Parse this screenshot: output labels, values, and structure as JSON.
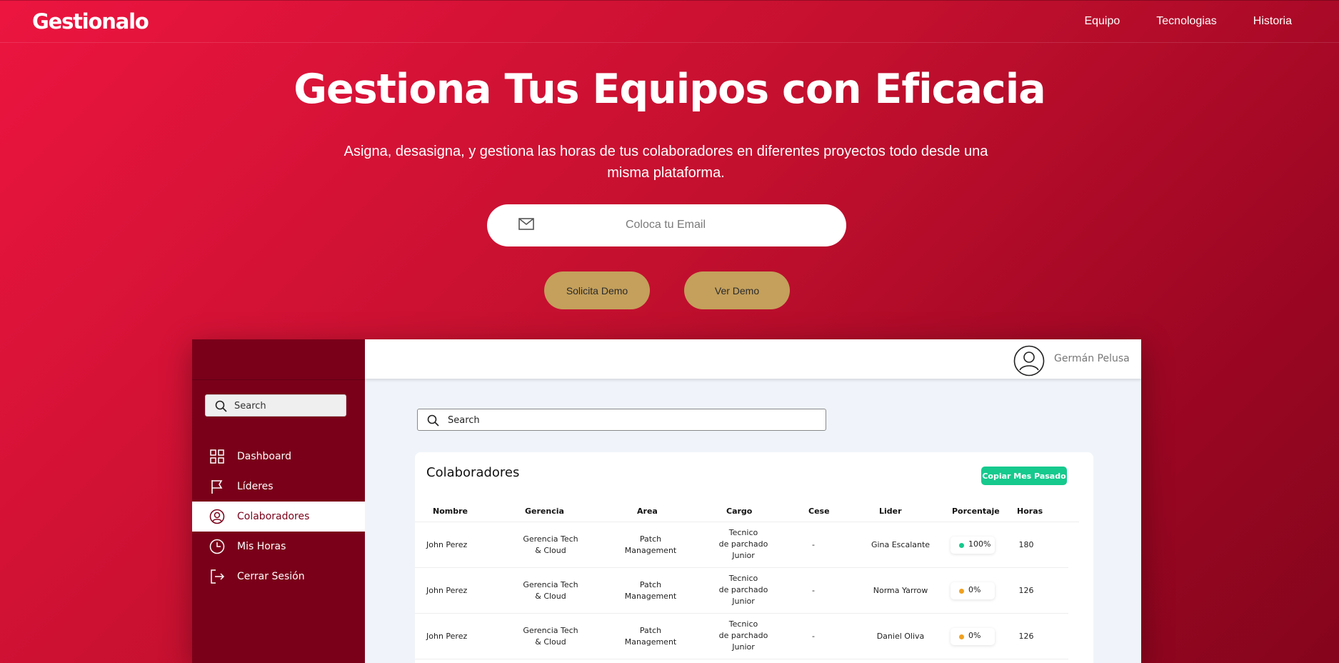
{
  "nav": {
    "logo": "Gestionalo",
    "links": [
      "Equipo",
      "Tecnologias",
      "Historia"
    ]
  },
  "hero": {
    "title": "Gestiona Tus Equipos con Eficacia",
    "subtitle": "Asigna, desasigna, y gestiona las horas de tus colaboradores en diferentes proyectos todo desde una misma plataforma.",
    "email_placeholder": "Coloca tu Email",
    "btn_solicita": "Solicita Demo",
    "btn_ver": "Ver Demo"
  },
  "app": {
    "sidebar": {
      "search_placeholder": "Search",
      "items": [
        {
          "label": "Dashboard",
          "icon": "grid-icon"
        },
        {
          "label": "Líderes",
          "icon": "flag-icon"
        },
        {
          "label": "Colaboradores",
          "icon": "user-circle-icon",
          "active": true
        },
        {
          "label": "Mis Horas",
          "icon": "clock-icon"
        },
        {
          "label": "Cerrar Sesión",
          "icon": "logout-icon"
        }
      ]
    },
    "user_name": "Germán Pelusa",
    "search_placeholder": "Search",
    "card": {
      "title": "Colaboradores",
      "copy_button": "Copiar Mes Pasado",
      "headers": [
        "Nombre",
        "Gerencia",
        "Area",
        "Cargo",
        "Cese",
        "Lider",
        "Porcentaje",
        "Horas"
      ],
      "rows": [
        {
          "nombre": "John Perez",
          "gerencia": [
            "Gerencia Tech",
            "& Cloud"
          ],
          "area": [
            "Patch",
            "Management"
          ],
          "cargo": [
            "Tecnico",
            "de parchado",
            "Junior"
          ],
          "cese": "-",
          "lider": "Gina  Escalante",
          "porcentaje": "100%",
          "status_color": "#16c98d",
          "horas": "180"
        },
        {
          "nombre": "John Perez",
          "gerencia": [
            "Gerencia Tech",
            "& Cloud"
          ],
          "area": [
            "Patch",
            "Management"
          ],
          "cargo": [
            "Tecnico",
            "de parchado",
            "Junior"
          ],
          "cese": "-",
          "lider": "Norma Yarrow",
          "porcentaje": "0%",
          "status_color": "#f0a020",
          "horas": "126"
        },
        {
          "nombre": "John Perez",
          "gerencia": [
            "Gerencia Tech",
            "& Cloud"
          ],
          "area": [
            "Patch",
            "Management"
          ],
          "cargo": [
            "Tecnico",
            "de parchado",
            "Junior"
          ],
          "cese": "-",
          "lider": "Daniel Oliva",
          "porcentaje": "0%",
          "status_color": "#f0a020",
          "horas": "126"
        }
      ]
    }
  },
  "colors": {
    "brand_red": "#d1123a",
    "sidebar": "#7a0019",
    "gold_button": "#c4a05c",
    "green": "#16c98d",
    "orange": "#f0a020"
  }
}
